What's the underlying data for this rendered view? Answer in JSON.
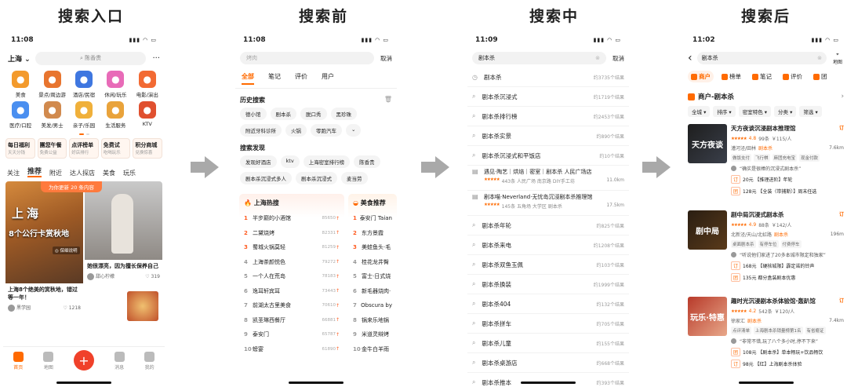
{
  "labels": [
    "搜索入口",
    "搜索前",
    "搜索中",
    "搜索后"
  ],
  "colors": {
    "accent": "#ff6a00",
    "red": "#f0412a",
    "arrow": "#a9a9a9"
  },
  "p1": {
    "time": "11:08",
    "city": "上海",
    "search_placeholder": "陈香贵",
    "more": "···",
    "grid": [
      {
        "label": "美食",
        "icon": "food-icon",
        "color": "#f39a2c"
      },
      {
        "label": "景点/周边游",
        "icon": "pagoda-icon",
        "color": "#e8752f"
      },
      {
        "label": "酒店/民宿",
        "icon": "hotel-icon",
        "color": "#3f77e0"
      },
      {
        "label": "休闲/玩乐",
        "icon": "cocktail-icon",
        "color": "#e86bb8"
      },
      {
        "label": "电影/演出",
        "icon": "movie-icon",
        "color": "#f26a33"
      },
      {
        "label": "医疗/口腔",
        "icon": "medical-icon",
        "color": "#4a8ff0"
      },
      {
        "label": "美发/男士",
        "icon": "hair-icon",
        "color": "#d18a4e"
      },
      {
        "label": "亲子/乐园",
        "icon": "kids-icon",
        "color": "#f0b03a"
      },
      {
        "label": "生活服务",
        "icon": "service-icon",
        "color": "#e9a33b"
      },
      {
        "label": "KTV",
        "icon": "mic-icon",
        "color": "#e0502f"
      }
    ],
    "promos": [
      {
        "title": "每日福利",
        "sub": "天天分钱"
      },
      {
        "title": "團您午餐",
        "sub": "免费公益"
      },
      {
        "title": "点评榜单",
        "sub": "好店排行"
      },
      {
        "title": "免费试",
        "sub": "吃喝玩乐"
      },
      {
        "title": "积分商城",
        "sub": "兑换惊喜"
      }
    ],
    "feed_tabs": [
      "关注",
      "推荐",
      "附近",
      "达人探店",
      "美食",
      "玩乐"
    ],
    "fresh": "为你更新 20 条内容",
    "card1": {
      "big": "上海",
      "big2": "8个公行卡赏秋地",
      "tag": "◎ 保细说明",
      "title": "上海8个绝美的赏秋地，错过等一年！",
      "user": "黑学园",
      "likes": "1218"
    },
    "card2": {
      "title": "她很漂亮，因为擅长保养自己",
      "user": "甜心柠檬",
      "likes": "319"
    },
    "nav": [
      "首页",
      "地图",
      "+",
      "消息",
      "我的"
    ]
  },
  "p2": {
    "time": "11:08",
    "placeholder": "烤肉",
    "cancel": "取消",
    "tabs": [
      "全部",
      "笔记",
      "评价",
      "用户"
    ],
    "history_title": "历史搜索",
    "history": [
      "德小馆",
      "剧本杀",
      "脱口秀",
      "黑珍珠",
      "附近牙科诊所",
      "火锅",
      "零跑汽车",
      "⌄"
    ],
    "discover_title": "搜索发现",
    "discover": [
      "发现好酒店",
      "ktv",
      "上海密室排行榜",
      "陈香贵",
      "剧本杀沉浸式多人",
      "剧本杀沉浸式",
      "麦当劳"
    ],
    "hot_title": "上海热搜",
    "hot": [
      {
        "n": "1",
        "name": "半步巅的小酒馆",
        "v": "85650"
      },
      {
        "n": "2",
        "name": "二黛烧烤",
        "v": "82331"
      },
      {
        "n": "3",
        "name": "蜀城火锅莫轻",
        "v": "81259"
      },
      {
        "n": "4",
        "name": "上海茶颜悦色",
        "v": "79272"
      },
      {
        "n": "5",
        "name": "一个人在荒岛",
        "v": "78183"
      },
      {
        "n": "6",
        "name": "逸耳轩宾耳",
        "v": "73443"
      },
      {
        "n": "7",
        "name": "前湖太古里美食",
        "v": "70610"
      },
      {
        "n": "8",
        "name": "凯圣琳西餐厅",
        "v": "66881"
      },
      {
        "n": "9",
        "name": "泰安门",
        "v": "65787"
      },
      {
        "n": "10",
        "name": "螃宴",
        "v": "61890"
      }
    ],
    "food_title": "美食推荐",
    "food": [
      "泰安门 Taian",
      "东方景霞",
      "美蛙鱼头·毛",
      "桂花龙井臀",
      "富士·日式烧",
      "新毛器烧肉·",
      "Obscura by",
      "锅来乐地锅",
      "米道灵辩烤",
      "金牛白羊雨"
    ]
  },
  "p3": {
    "time": "11:09",
    "query": "剧本杀",
    "cancel": "取消",
    "suggestions": [
      {
        "text": "剧本杀",
        "count": "约3735个结果"
      },
      {
        "text": "剧本杀沉浸式",
        "count": "约1719个结果"
      },
      {
        "text": "剧本杀排行榜",
        "count": "约2453个结果"
      },
      {
        "text": "剧本杀实景",
        "count": "约890个结果"
      },
      {
        "text": "剧本杀沉浸式和平饭店",
        "count": "约10个结果"
      }
    ],
    "poi": [
      {
        "name": "遇见·陶艺｜烘焙｜密室｜剧本杀 人民广场店",
        "stars": "★★★★★",
        "info": "443条  人民广场 南京路 DIY手工坊",
        "dist": "11.0km"
      },
      {
        "name": "剧本喵·Neverland·无忧岛沉浸剧本杀推理馆",
        "stars": "★★★★★",
        "info": "145条  五角场 大学区 剧本杀",
        "dist": "17.5km"
      }
    ],
    "suggestions2": [
      {
        "text": "剧本杀年轮",
        "count": "约825个结果"
      },
      {
        "text": "剧本杀来电",
        "count": "约1208个结果"
      },
      {
        "text": "剧本杀双鱼玉佩",
        "count": "约103个结果"
      },
      {
        "text": "剧本杀换装",
        "count": "约1999个结果"
      },
      {
        "text": "剧本杀404",
        "count": "约132个结果"
      },
      {
        "text": "剧本杀拼车",
        "count": "约705个结果"
      },
      {
        "text": "剧本杀儿童",
        "count": "约155个结果"
      },
      {
        "text": "剧本杀桌游店",
        "count": "约668个结果"
      },
      {
        "text": "剧本杀推本",
        "count": "约393个结果"
      }
    ]
  },
  "p4": {
    "time": "11:02",
    "query": "剧本杀",
    "map": "地图",
    "tabs": [
      "商户",
      "榜单",
      "笔记",
      "评价",
      "团"
    ],
    "head": "商户-剧本杀",
    "filters": [
      "全城",
      "排序",
      "密室特色",
      "分类",
      "筛选"
    ],
    "shops": [
      {
        "thumb": "天方夜谈",
        "name": "天方夜谈沉浸剧本推理馆",
        "dg": "订",
        "score": "4.8",
        "reviews": "99条",
        "price": "￥115/人",
        "area": "漕河泾/田林",
        "cat": "剧本杀",
        "dist": "7.6km",
        "feats": [
          "做饭支付",
          "飞行棋",
          "麻团充电宝",
          "现金付款"
        ],
        "quote": "“确实是很棒的沉浸式剧本杀”",
        "deals": [
          {
            "tag": "订",
            "text": "20元 【推理进阶】年轮"
          },
          {
            "tag": "团",
            "text": "128元 【全装（带捕斯）】周末任选"
          }
        ]
      },
      {
        "thumb": "剧中局",
        "name": "剧中局沉浸式剧本杀",
        "dg": "订",
        "score": "4.9",
        "reviews": "88条",
        "price": "￥142/人",
        "area": "北新泾/天山/北虹路",
        "cat": "剧本杀",
        "dist": "196m",
        "feats": [
          "桌面剧本杀",
          "有停车位",
          "付费停车"
        ],
        "quote": "“听说他们家进了20多本城市限定和独家”",
        "deals": [
          {
            "tag": "订",
            "text": "168元 【硬核城限】霹定诺的铃声"
          },
          {
            "tag": "团",
            "text": "135元 都分盒装剧本优惠"
          }
        ]
      },
      {
        "thumb": "玩乐·特惠",
        "name": "趣时光沉浸剧本杀体验馆·轰趴馆",
        "dg": "订",
        "score": "4.2",
        "reviews": "542条",
        "price": "￥120/人",
        "area": "徐家汇",
        "cat": "剧本杀",
        "dist": "7.4km",
        "feats": [
          "点评清单",
          "上海剧本杀销量榜第1名",
          "有省瘾证"
        ],
        "quote": "“非常不错,玩了八个多小时,停不下来”",
        "deals": [
          {
            "tag": "团",
            "text": "108元 【剧本杀】单本畅玩+饮品畅饮"
          },
          {
            "tag": "订",
            "text": "98元 【红】上海剧本杀体验"
          }
        ]
      }
    ]
  }
}
